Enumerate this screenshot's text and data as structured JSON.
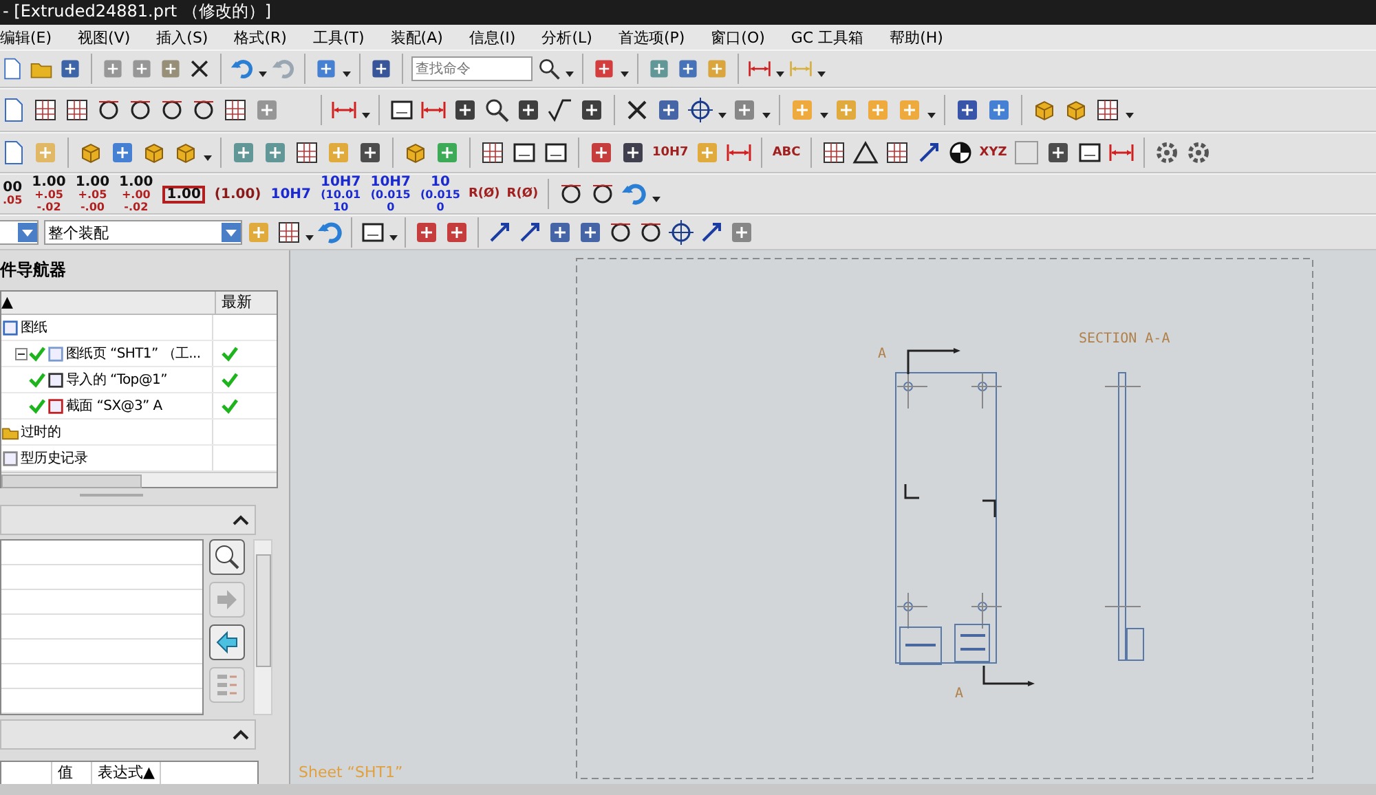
{
  "window": {
    "title": "- [Extruded24881.prt （修改的）]"
  },
  "menu": [
    "编辑(E)",
    "视图(V)",
    "插入(S)",
    "格式(R)",
    "工具(T)",
    "装配(A)",
    "信息(I)",
    "分析(L)",
    "首选项(P)",
    "窗口(O)",
    "GC 工具箱",
    "帮助(H)"
  ],
  "search": {
    "placeholder": "查找命令"
  },
  "toolbar_labels": [
    "10H7",
    "ABC",
    "XYZ",
    "R(Ø)",
    "R(Ø)"
  ],
  "dimension_styles": [
    {
      "kind": "tol",
      "main": "00",
      "upper": ".05"
    },
    {
      "kind": "tol",
      "main": "1.00",
      "upper": "+.05",
      "lower": "-.02"
    },
    {
      "kind": "tol",
      "main": "1.00",
      "upper": "+.05",
      "lower": "-.00"
    },
    {
      "kind": "tol",
      "main": "1.00",
      "upper": "+.00",
      "lower": "-.02"
    },
    {
      "kind": "basic",
      "main": "1.00"
    },
    {
      "kind": "reference",
      "main": "(1.00)"
    },
    {
      "kind": "fit",
      "main": "10H7"
    },
    {
      "kind": "limits",
      "main": "10H7",
      "upper": "(10.01",
      "lower": "10"
    },
    {
      "kind": "limits",
      "main": "10H7",
      "upper": "(0.015",
      "lower": "0"
    },
    {
      "kind": "limits",
      "main": "10",
      "upper": "(0.015",
      "lower": "0"
    }
  ],
  "filter": {
    "value": "整个装配"
  },
  "navigator": {
    "title": "件导航器",
    "columns": {
      "sort_indicator": "▲",
      "latest": "最新"
    },
    "tree": [
      {
        "kind": "drawing",
        "label": "图纸",
        "children": [
          {
            "kind": "sheet",
            "label": "图纸页 “SHT1” （工...",
            "ok": true,
            "latest": true,
            "expanded": true,
            "children": [
              {
                "kind": "view",
                "label": "导入的 “Top@1”",
                "ok": true,
                "latest": true
              },
              {
                "kind": "section",
                "label": "截面 “SX@3” A",
                "ok": true,
                "latest": true
              }
            ]
          }
        ]
      },
      {
        "kind": "outdated",
        "label": "过时的"
      },
      {
        "kind": "history",
        "label": "型历史记录"
      }
    ]
  },
  "details": {
    "columns": [
      {
        "label": "值"
      },
      {
        "label": "表达式",
        "sort": "▲"
      }
    ]
  },
  "drawing": {
    "section_title": "SECTION A-A",
    "cut_labels": [
      "A",
      "A"
    ],
    "sheet_label": "Sheet “SHT1”"
  }
}
